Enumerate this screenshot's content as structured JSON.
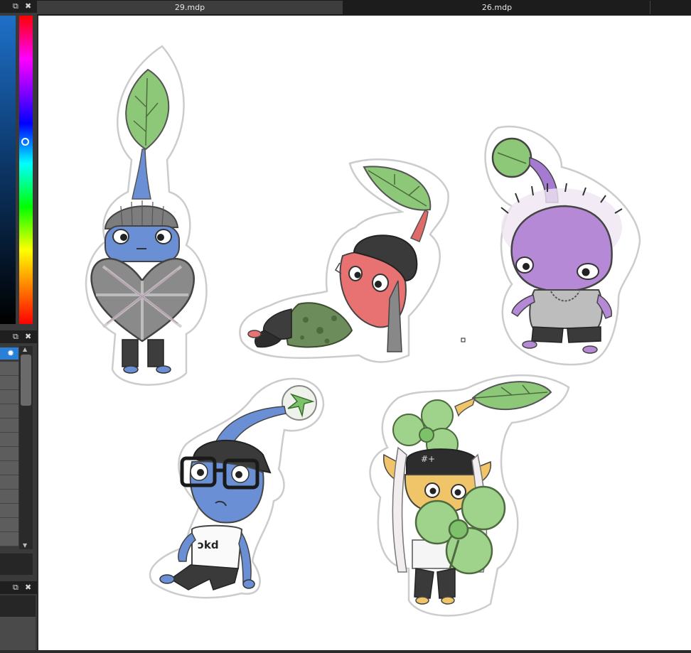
{
  "tabs": [
    {
      "label": "29.mdp"
    },
    {
      "label": "26.mdp"
    }
  ],
  "colors": {
    "panel_bg": "#3a3a3a",
    "tab_bar_bg": "#1c1c1c",
    "active_tab_bg": "#3d3d3d",
    "canvas_bg": "#ffffff",
    "selected_item": "#2b7fd6"
  },
  "icons": {
    "panel_detach": "detach-icon",
    "panel_close": "close-icon",
    "layer_settings": "gear-icon",
    "scroll_up": "scroll-up-arrow-icon",
    "scroll_down": "scroll-down-arrow-icon"
  },
  "canvas": {
    "artwork_subjects": [
      "blue-pikmin-helmet",
      "red-pikmin-lounging",
      "purple-pikmin",
      "blue-pikmin-glasses",
      "yellow-pikmin-clover"
    ]
  }
}
